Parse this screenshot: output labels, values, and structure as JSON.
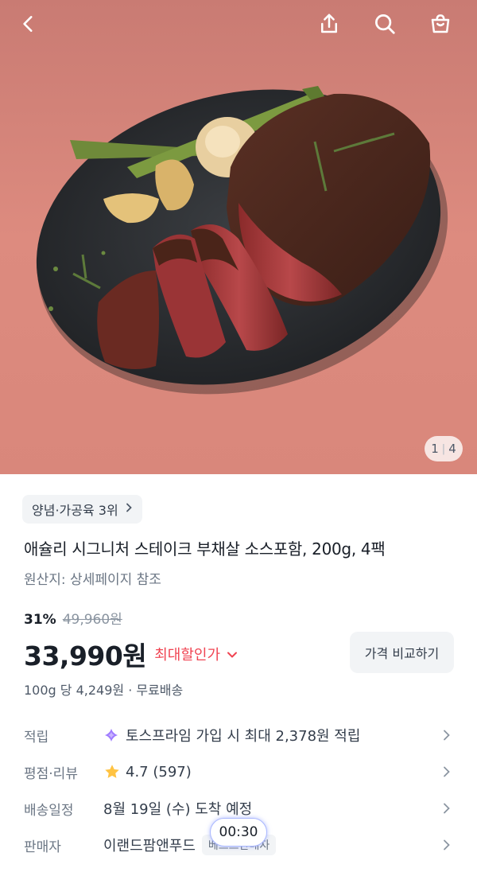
{
  "hero": {
    "pager_current": "1",
    "pager_total": "4"
  },
  "product": {
    "rank_chip": "양념·가공육 3위",
    "title": "애슐리 시그니처 스테이크 부채살 소스포함, 200g, 4팩",
    "origin": "원산지: 상세페이지 참조",
    "discount_rate": "31%",
    "original_price": "49,960원",
    "price": "33,990원",
    "max_discount_label": "최대할인가",
    "compare_button": "가격 비교하기",
    "unit_price": "100g 당 4,249원 · 무료배송"
  },
  "info": {
    "points_label": "적립",
    "points_value": "토스프라임 가입 시 최대 2,378원 적립",
    "rating_label": "평점·리뷰",
    "rating_value": "4.7 (597)",
    "delivery_label": "배송일정",
    "delivery_value": "8월 19일 (수) 도착 예정",
    "seller_label": "판매자",
    "seller_value": "이랜드팜앤푸드",
    "seller_badge": "베스트판매자"
  },
  "overlay": {
    "timer": "00:30"
  },
  "colors": {
    "accent_red": "#f04452",
    "star": "#ffc342",
    "prime_icon": "#9f7bff",
    "background_pink": "#d98378"
  },
  "icons": [
    "back-icon",
    "share-icon",
    "search-icon",
    "cart-icon",
    "chevron-right-icon",
    "chevron-down-icon",
    "star-icon",
    "prime-icon"
  ]
}
